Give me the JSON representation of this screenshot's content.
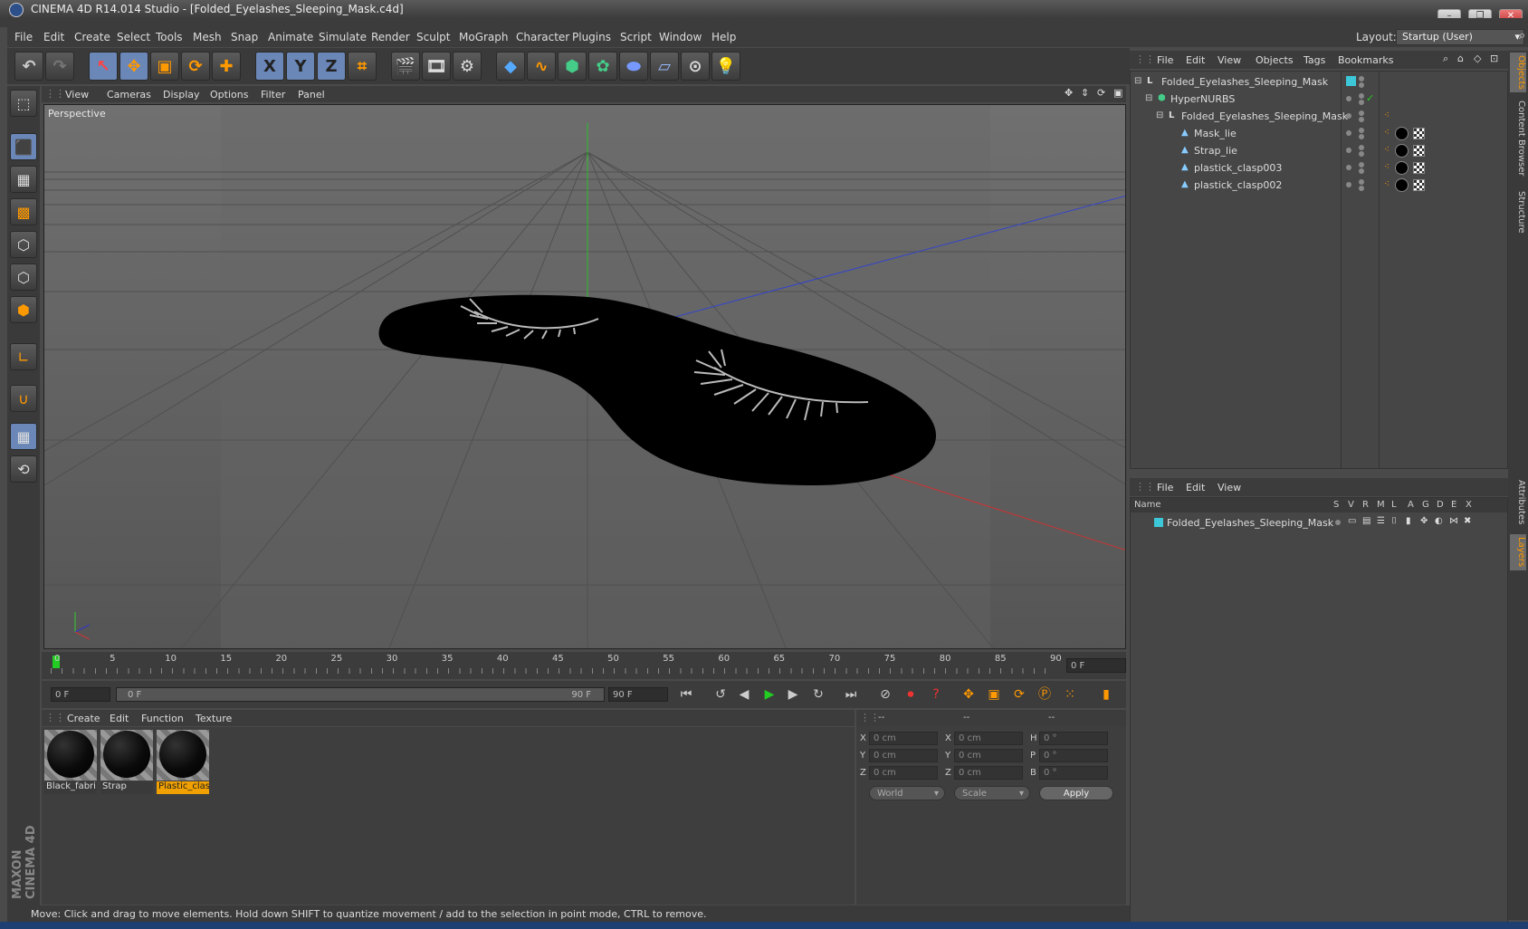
{
  "window": {
    "title": "CINEMA 4D R14.014 Studio - [Folded_Eyelashes_Sleeping_Mask.c4d]",
    "buttons": [
      "–",
      "❐",
      "✕"
    ]
  },
  "menu": [
    "File",
    "Edit",
    "Create",
    "Select",
    "Tools",
    "Mesh",
    "Snap",
    "Animate",
    "Simulate",
    "Render",
    "Sculpt",
    "MoGraph",
    "Character",
    "Plugins",
    "Script",
    "Window",
    "Help"
  ],
  "layout": {
    "label": "Layout:",
    "value": "Startup (User)"
  },
  "toolbar": {
    "icons": [
      "undo-icon",
      "redo-icon",
      "select-icon",
      "move-icon",
      "scale-icon",
      "rotate-icon",
      "add-icon",
      "x-axis-icon",
      "y-axis-icon",
      "z-axis-icon",
      "coordinate-system-icon",
      "render-view-icon",
      "render-picture-viewer-icon",
      "render-settings-icon",
      "cube-icon",
      "spline-icon",
      "nurbs-icon",
      "array-icon",
      "deformer-icon",
      "floor-icon",
      "camera-icon",
      "light-icon"
    ],
    "axis_labels": [
      "X",
      "Y",
      "Z"
    ]
  },
  "viewport": {
    "menu": [
      "View",
      "Cameras",
      "Display",
      "Options",
      "Filter",
      "Panel"
    ],
    "camera_label": "Perspective"
  },
  "timeline": {
    "ticks": [
      "0",
      "5",
      "10",
      "15",
      "20",
      "25",
      "30",
      "35",
      "40",
      "45",
      "50",
      "55",
      "60",
      "65",
      "70",
      "75",
      "80",
      "85",
      "90"
    ],
    "current_frame": "0 F",
    "start_field": "0 F",
    "range_start": "0 F",
    "range_end": "90 F",
    "end_field": "90 F"
  },
  "materials": {
    "menu": [
      "Create",
      "Edit",
      "Function",
      "Texture"
    ],
    "items": [
      {
        "name": "Black_fabri",
        "selected": false
      },
      {
        "name": "Strap",
        "selected": false
      },
      {
        "name": "Plastic_clas",
        "selected": true
      }
    ]
  },
  "coords": {
    "headers": [
      "--",
      "--",
      "--"
    ],
    "rows": [
      {
        "a": "X",
        "av": "0 cm",
        "b": "X",
        "bv": "0 cm",
        "c": "H",
        "cv": "0 °"
      },
      {
        "a": "Y",
        "av": "0 cm",
        "b": "Y",
        "bv": "0 cm",
        "c": "P",
        "cv": "0 °"
      },
      {
        "a": "Z",
        "av": "0 cm",
        "b": "Z",
        "bv": "0 cm",
        "c": "B",
        "cv": "0 °"
      }
    ],
    "mode": "World",
    "transform": "Scale",
    "apply": "Apply"
  },
  "status": "Move: Click and drag to move elements. Hold down SHIFT to quantize movement / add to the selection in point mode, CTRL to remove.",
  "objects": {
    "menu": [
      "File",
      "Edit",
      "View",
      "Objects",
      "Tags",
      "Bookmarks"
    ],
    "tree": [
      {
        "name": "Folded_Eyelashes_Sleeping_Mask",
        "depth": 0,
        "icon": "null-object-icon"
      },
      {
        "name": "HyperNURBS",
        "depth": 1,
        "icon": "hypernurbs-icon"
      },
      {
        "name": "Folded_Eyelashes_Sleeping_Mask",
        "depth": 2,
        "icon": "null-object-icon"
      },
      {
        "name": "Mask_lie",
        "depth": 3,
        "icon": "polygon-object-icon"
      },
      {
        "name": "Strap_lie",
        "depth": 3,
        "icon": "polygon-object-icon"
      },
      {
        "name": "plastick_clasp003",
        "depth": 3,
        "icon": "polygon-object-icon"
      },
      {
        "name": "plastick_clasp002",
        "depth": 3,
        "icon": "polygon-object-icon"
      }
    ]
  },
  "layers": {
    "menu": [
      "File",
      "Edit",
      "View"
    ],
    "columns": [
      "Name",
      "S",
      "V",
      "R",
      "M",
      "L",
      "A",
      "G",
      "D",
      "E",
      "X"
    ],
    "rows": [
      {
        "name": "Folded_Eyelashes_Sleeping_Mask",
        "color": "#3cc8d8"
      }
    ]
  },
  "side_tabs": [
    "Objects",
    "Content Browser",
    "Structure",
    "Attributes",
    "Layers"
  ],
  "brand": "MAXON CINEMA 4D",
  "colors": {
    "accent": "#f0a000",
    "x_axis": "#cc3333",
    "y_axis": "#33cc33",
    "z_axis": "#3344cc",
    "layer": "#3cc8d8"
  }
}
